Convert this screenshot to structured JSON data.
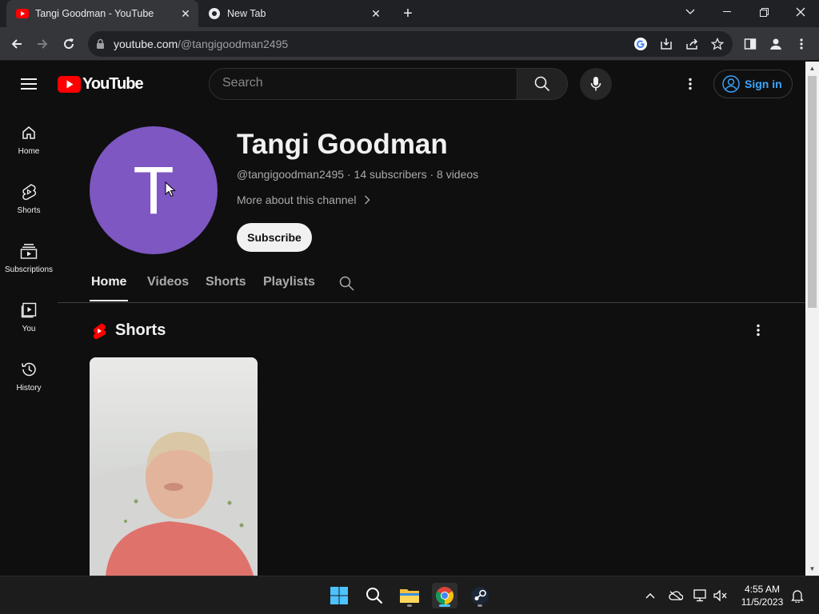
{
  "browser": {
    "tabs": [
      {
        "title": "Tangi Goodman - YouTube",
        "active": true
      },
      {
        "title": "New Tab",
        "active": false
      }
    ],
    "url_host": "youtube.com",
    "url_path": "/@tangigoodman2495"
  },
  "youtube": {
    "logo_text": "YouTube",
    "search_placeholder": "Search",
    "signin_label": "Sign in",
    "guide": [
      {
        "label": "Home",
        "icon": "home-icon"
      },
      {
        "label": "Shorts",
        "icon": "shorts-icon"
      },
      {
        "label": "Subscriptions",
        "icon": "subscriptions-icon"
      },
      {
        "label": "You",
        "icon": "you-icon"
      },
      {
        "label": "History",
        "icon": "history-icon"
      }
    ],
    "channel": {
      "avatar_letter": "T",
      "avatar_color": "#7e57c2",
      "name": "Tangi Goodman",
      "meta": "@tangigoodman2495 · 14 subscribers · 8 videos",
      "more_label": "More about this channel",
      "subscribe_label": "Subscribe"
    },
    "tabs": [
      "Home",
      "Videos",
      "Shorts",
      "Playlists"
    ],
    "active_tab": "Home",
    "shelf_title": "Shorts"
  },
  "taskbar": {
    "time": "4:55 AM",
    "date": "11/5/2023"
  }
}
